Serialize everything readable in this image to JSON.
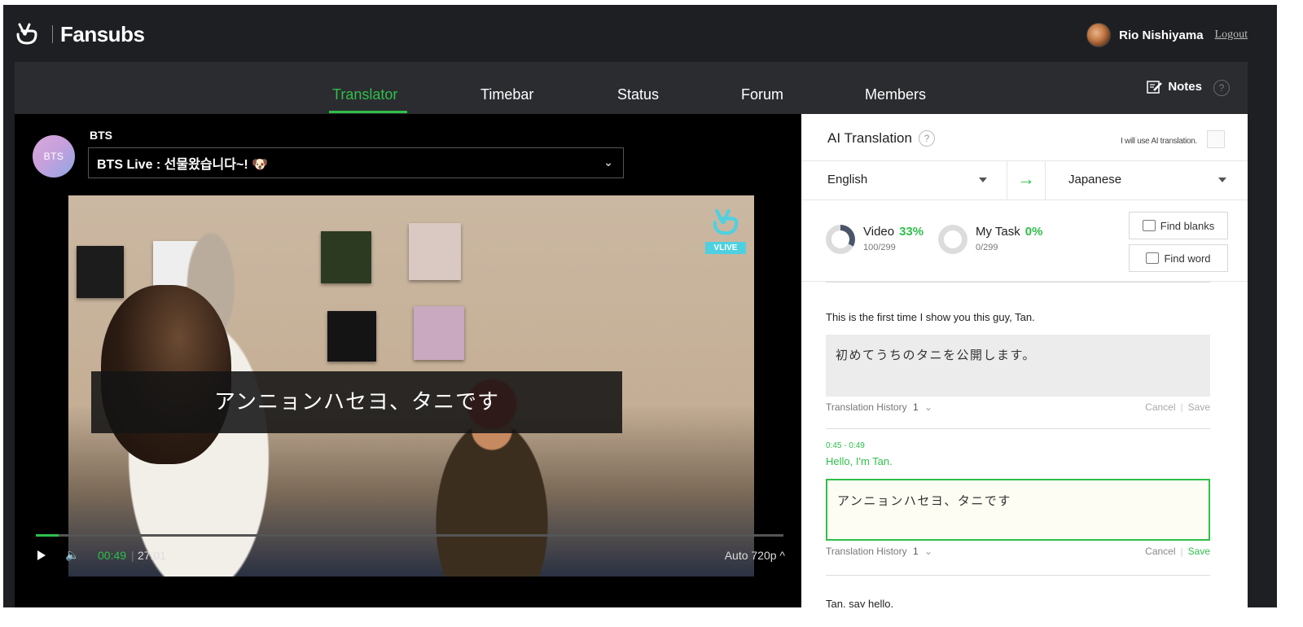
{
  "app": {
    "brand": "Fansubs",
    "user_name": "Rio Nishiyama",
    "logout": "Logout"
  },
  "nav": {
    "tabs": [
      "Translator",
      "Timebar",
      "Status",
      "Forum",
      "Members"
    ],
    "active_tab": "Translator",
    "notes": "Notes",
    "help": "?"
  },
  "player": {
    "channel_name": "BTS",
    "channel_avatar_text": "BTS",
    "live_title": "BTS Live : 선물왔습니다~! 🐶",
    "vlive_badge": "VLIVE",
    "subtitle": "アンニョンハセヨ、タニです",
    "time_current": "00:49",
    "time_separator": "|",
    "time_total": "27:01",
    "progress_fraction": 0.03,
    "quality": "Auto 720p ^"
  },
  "ai": {
    "title": "AI Translation",
    "help": "?",
    "checkbox_label": "I will use AI translation.",
    "source_lang": "English",
    "target_lang": "Japanese",
    "arrow": "→"
  },
  "stats": {
    "video_label": "Video",
    "video_pct": "33%",
    "video_pct_value": 33,
    "video_sub": "100/299",
    "task_label": "My Task",
    "task_pct": "0%",
    "task_pct_value": 0,
    "task_sub": "0/299",
    "find_blanks": "Find blanks",
    "find_word": "Find word"
  },
  "segments": [
    {
      "time": "",
      "source": "This is the first time I show you this guy, Tan.",
      "translation": "初めてうちのタニを公開します。",
      "history_label": "Translation History",
      "history_count": "1",
      "cancel": "Cancel",
      "separator": "|",
      "save": "Save"
    },
    {
      "time": "0:45 - 0:49",
      "source": "Hello, I'm Tan.",
      "translation": "アンニョンハセヨ、タニです",
      "history_label": "Translation History",
      "history_count": "1",
      "cancel": "Cancel",
      "separator": "|",
      "save": "Save"
    },
    {
      "source": "Tan, say hello."
    }
  ],
  "colors": {
    "accent": "#2fbf4a",
    "dark_bg": "#1e1f22",
    "nav_bg": "#2b2c30"
  }
}
